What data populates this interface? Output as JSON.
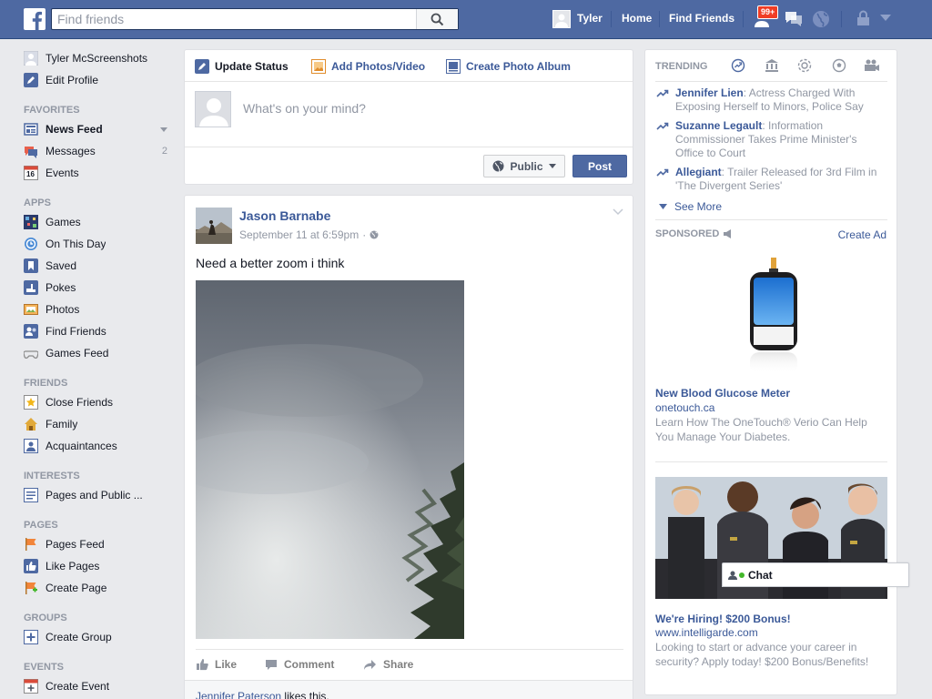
{
  "topbar": {
    "search_placeholder": "Find friends",
    "user_name": "Tyler",
    "home_label": "Home",
    "find_friends_label": "Find Friends",
    "notifications_count": "99+"
  },
  "left_nav": {
    "profile_name": "Tyler McScreenshots",
    "edit_profile": "Edit Profile",
    "sections": {
      "favorites": "FAVORITES",
      "apps": "APPS",
      "friends": "FRIENDS",
      "interests": "INTERESTS",
      "pages": "PAGES",
      "groups": "GROUPS",
      "events": "EVENTS"
    },
    "favorites": [
      {
        "label": "News Feed",
        "icon": "news-feed-icon"
      },
      {
        "label": "Messages",
        "icon": "messages-icon",
        "count": "2"
      },
      {
        "label": "Events",
        "icon": "calendar-icon",
        "badge": "16"
      }
    ],
    "apps": [
      {
        "label": "Games",
        "icon": "games-icon"
      },
      {
        "label": "On This Day",
        "icon": "on-this-day-icon"
      },
      {
        "label": "Saved",
        "icon": "bookmark-icon"
      },
      {
        "label": "Pokes",
        "icon": "poke-icon"
      },
      {
        "label": "Photos",
        "icon": "photos-icon"
      },
      {
        "label": "Find Friends",
        "icon": "find-friends-icon"
      },
      {
        "label": "Games Feed",
        "icon": "gamepad-icon"
      }
    ],
    "friends": [
      {
        "label": "Close Friends",
        "icon": "star-icon"
      },
      {
        "label": "Family",
        "icon": "house-icon"
      },
      {
        "label": "Acquaintances",
        "icon": "acquaintances-icon"
      }
    ],
    "interests": [
      {
        "label": "Pages and Public ...",
        "icon": "pages-list-icon"
      }
    ],
    "pages": [
      {
        "label": "Pages Feed",
        "icon": "flag-icon"
      },
      {
        "label": "Like Pages",
        "icon": "thumbs-up-icon"
      },
      {
        "label": "Create Page",
        "icon": "create-page-icon"
      }
    ],
    "groups": [
      {
        "label": "Create Group",
        "icon": "plus-icon"
      }
    ],
    "events": [
      {
        "label": "Create Event",
        "icon": "create-event-icon"
      }
    ]
  },
  "composer": {
    "update_status": "Update Status",
    "add_photos": "Add Photos/Video",
    "create_album": "Create Photo Album",
    "placeholder": "What's on your mind?",
    "privacy": "Public",
    "post": "Post"
  },
  "post": {
    "author": "Jason Barnabe",
    "timestamp": "September 11 at 6:59pm",
    "text": "Need a better zoom i think",
    "like": "Like",
    "comment": "Comment",
    "share": "Share",
    "liker": "Jennifer Paterson",
    "likes_suffix": " likes this."
  },
  "right": {
    "trending_label": "TRENDING",
    "trending": [
      {
        "name": "Jennifer Lien",
        "desc": ": Actress Charged With Exposing Herself to Minors, Police Say"
      },
      {
        "name": "Suzanne Legault",
        "desc": ": Information Commissioner Takes Prime Minister's Office to Court"
      },
      {
        "name": "Allegiant",
        "desc": ": Trailer Released for 3rd Film in 'The Divergent Series'"
      }
    ],
    "see_more": "See More",
    "sponsored_label": "SPONSORED",
    "create_ad": "Create Ad",
    "ad1": {
      "title": "New Blood Glucose Meter",
      "url": "onetouch.ca",
      "body": "Learn How The OneTouch® Verio Can Help You Manage Your Diabetes."
    },
    "ad2": {
      "title": "We're Hiring! $200 Bonus!",
      "url": "www.intelligarde.com",
      "body": "Looking to start or advance your career in security? Apply today! $200 Bonus/Benefits!"
    }
  },
  "chat": {
    "label": "Chat"
  },
  "colors": {
    "brand_blue": "#4e69a2",
    "link_blue": "#3b5998",
    "page_bg": "#e9eaed",
    "muted_gray": "#9197a3"
  }
}
